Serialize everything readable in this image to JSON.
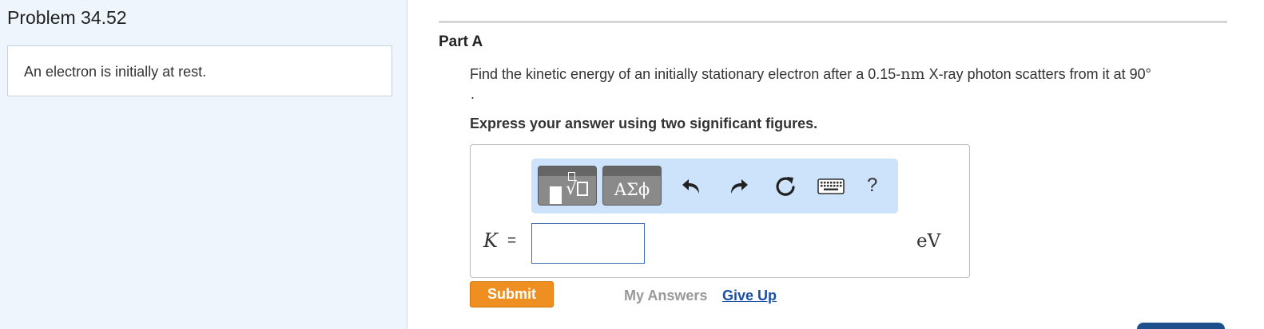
{
  "problem": {
    "title": "Problem 34.52",
    "intro": "An electron is initially at rest."
  },
  "part": {
    "label": "Part A",
    "question_pre": "Find the kinetic energy of an initially stationary electron after a 0.15-",
    "question_unit": "nm",
    "question_post": " X-ray photon scatters from it at 90°",
    "question_period": ".",
    "instruction": "Express your answer using two significant figures."
  },
  "toolbar": {
    "greek_label": "ΑΣϕ",
    "help_label": "?",
    "icons": [
      "templates-icon",
      "greek-letters-icon",
      "undo-icon",
      "redo-icon",
      "reset-icon",
      "keyboard-icon",
      "help-icon"
    ]
  },
  "answer": {
    "variable": "K",
    "equals": "=",
    "value": "",
    "unit": "eV"
  },
  "actions": {
    "submit_label": "Submit",
    "my_answers_label": "My Answers",
    "give_up_label": "Give Up"
  },
  "colors": {
    "left_pane_bg": "#eef5fd",
    "toolbar_bg": "#cce3fb",
    "submit_bg": "#ef8f22",
    "link": "#1a4fa8",
    "input_border": "#3d6fb0"
  }
}
